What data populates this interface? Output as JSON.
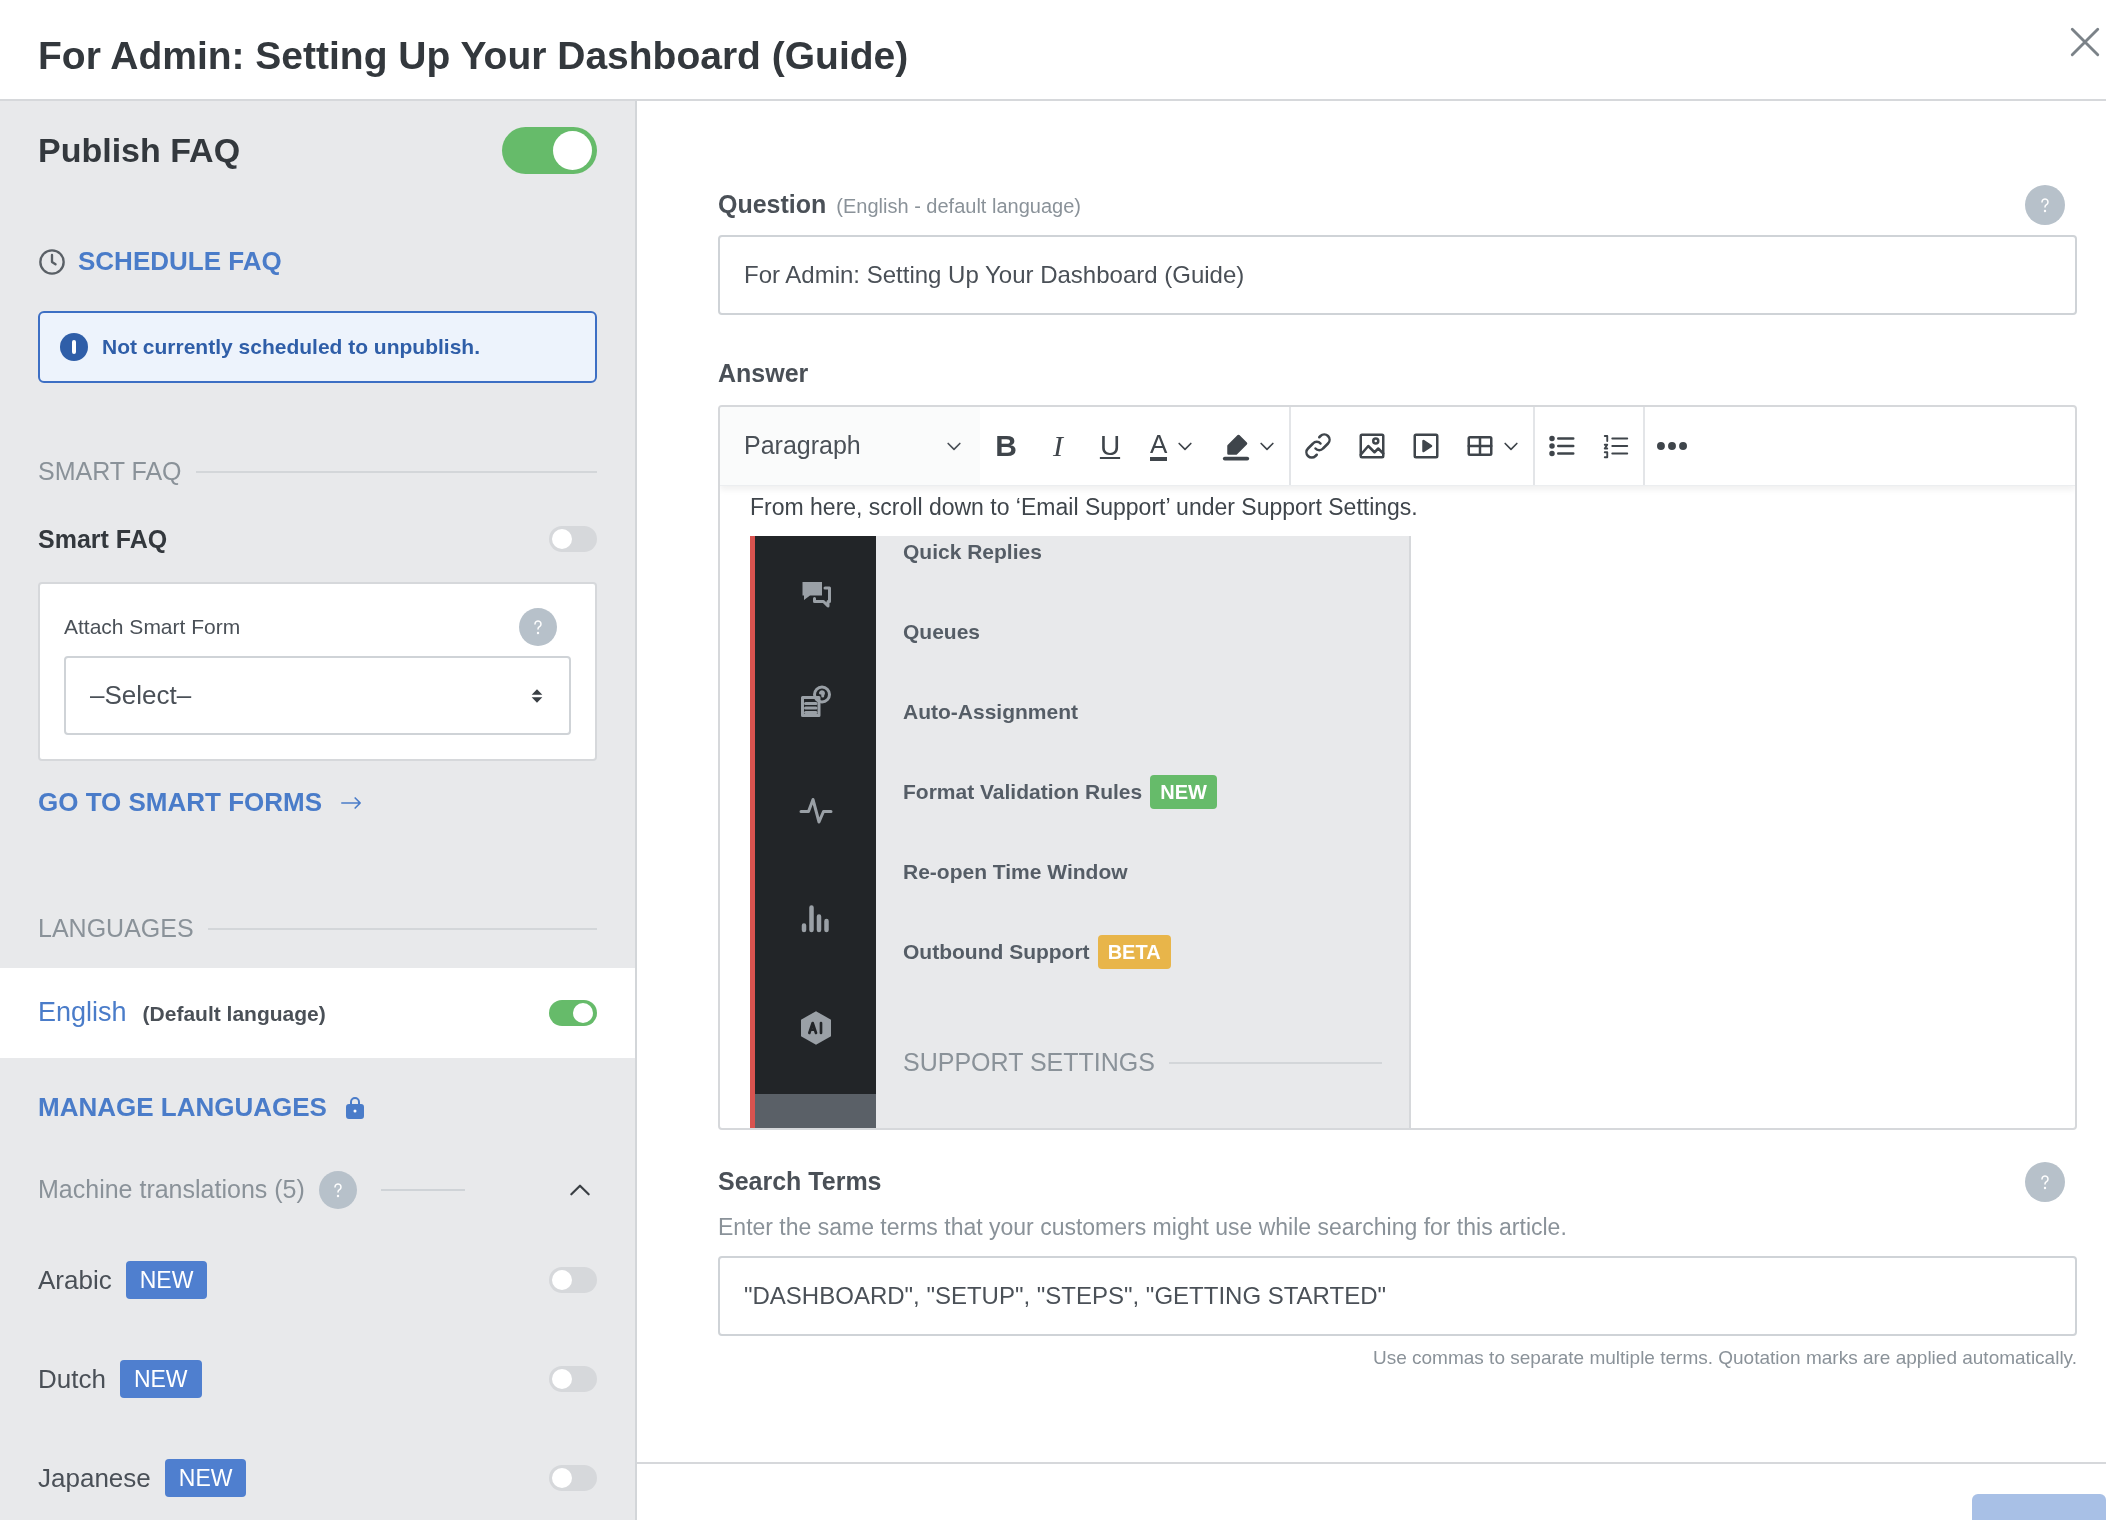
{
  "dialog": {
    "title": "For Admin: Setting Up Your Dashboard (Guide)"
  },
  "sidebar": {
    "publish": {
      "label": "Publish FAQ",
      "on": true
    },
    "schedule_link": "SCHEDULE FAQ",
    "schedule_notice": "Not currently scheduled to unpublish.",
    "smart_faq": {
      "heading": "SMART FAQ",
      "label": "Smart FAQ",
      "on": false,
      "attach_label": "Attach Smart Form",
      "select_value": "–Select–",
      "link": "GO TO SMART FORMS"
    },
    "languages": {
      "heading": "LANGUAGES",
      "default": {
        "name": "English",
        "note": "(Default language)",
        "on": true
      },
      "manage_link": "MANAGE LANGUAGES",
      "machine": {
        "label": "Machine translations (5)",
        "expanded": true
      },
      "items": [
        {
          "name": "Arabic",
          "badge": "NEW",
          "on": false
        },
        {
          "name": "Dutch",
          "badge": "NEW",
          "on": false
        },
        {
          "name": "Japanese",
          "badge": "NEW",
          "on": false
        }
      ]
    }
  },
  "question": {
    "label": "Question",
    "note": "(English - default language)",
    "value": "For Admin: Setting Up Your Dashboard (Guide)"
  },
  "answer": {
    "label": "Answer",
    "toolbar": [
      {
        "kind": "select",
        "label": "Paragraph"
      },
      {
        "kind": "bold",
        "label": "B"
      },
      {
        "kind": "italic",
        "label": "I"
      },
      {
        "kind": "underline",
        "label": "U"
      },
      {
        "kind": "text-color",
        "label": "A"
      },
      {
        "kind": "highlight"
      },
      {
        "kind": "link"
      },
      {
        "kind": "image"
      },
      {
        "kind": "video"
      },
      {
        "kind": "table"
      },
      {
        "kind": "bullet-list"
      },
      {
        "kind": "numbered-list"
      },
      {
        "kind": "more"
      }
    ],
    "text": "From here, scroll down to ‘Email Support’ under Support Settings.",
    "screenshot": {
      "items": [
        {
          "label": "Quick Replies"
        },
        {
          "label": "Queues"
        },
        {
          "label": "Auto-Assignment"
        },
        {
          "label": "Format Validation Rules",
          "badge": "NEW",
          "color": "#66bb6a"
        },
        {
          "label": "Re-open Time Window"
        },
        {
          "label": "Outbound Support",
          "badge": "BETA",
          "color": "#e8b54a"
        }
      ],
      "section": "SUPPORT SETTINGS"
    }
  },
  "search_terms": {
    "label": "Search Terms",
    "description": "Enter the same terms that your customers might use while searching for this article.",
    "value": "\"DASHBOARD\", \"SETUP\", \"STEPS\", \"GETTING STARTED\"",
    "hint": "Use commas to separate multiple terms. Quotation marks are applied automatically."
  }
}
